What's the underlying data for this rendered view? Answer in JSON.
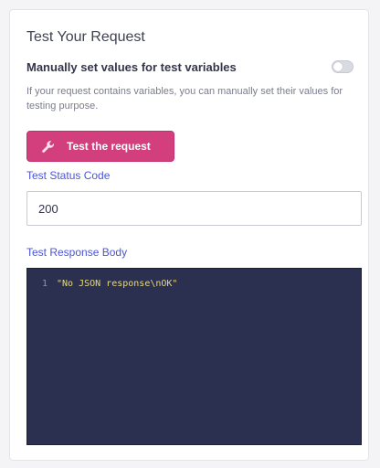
{
  "panel": {
    "title": "Test Your Request",
    "toggle": {
      "label": "Manually set values for test variables",
      "enabled": false
    },
    "help_text": "If your request contains variables, you can manually set their values for testing purpose."
  },
  "test_button": {
    "label": "Test the request",
    "icon": "wrench-icon",
    "color": "#d33f7c"
  },
  "status_code": {
    "label": "Test Status Code",
    "value": "200"
  },
  "response_body": {
    "label": "Test Response Body",
    "lines": [
      {
        "number": "1",
        "text": "\"No JSON response\\nOK\""
      }
    ]
  },
  "colors": {
    "accent_link": "#4a55d6",
    "editor_bg": "#2c3050",
    "code_string": "#e6d77a"
  }
}
